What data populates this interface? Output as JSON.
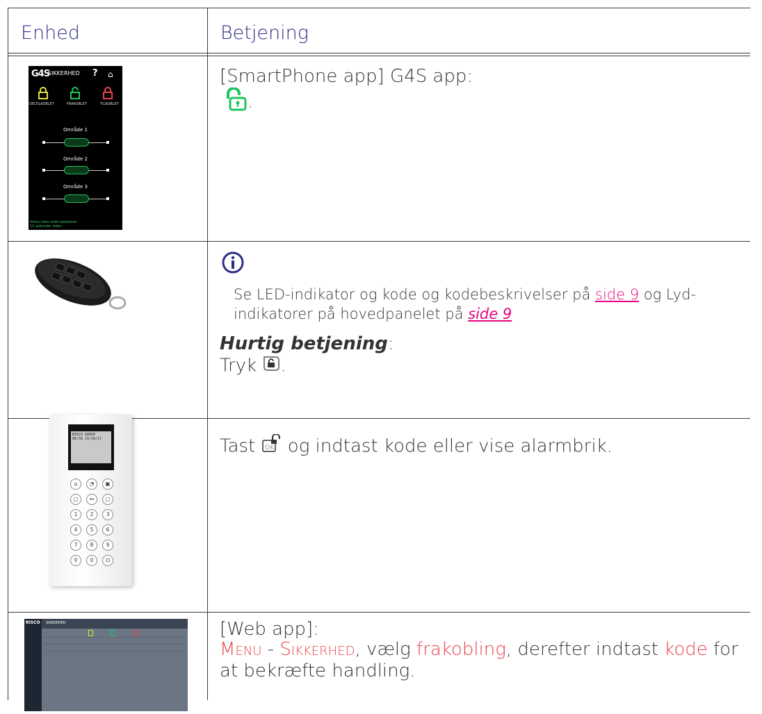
{
  "table": {
    "header": {
      "col_device": "Enhed",
      "col_operation": "Betjening"
    },
    "rows": [
      {
        "device_image": "smartphone-app-screenshot",
        "line1": "[SmartPhone app] G4S app:",
        "period": "."
      },
      {
        "device_image": "keyfob-remote",
        "info_prefix": "Se LED-indikator og kode og kodebeskrivelser på ",
        "link1": "side 9",
        "info_mid": " og Lyd-",
        "info_line2_prefix": "indikatorer på hovedpanelet på ",
        "link2": "side 9",
        "quick_label": "Hurtig betjening",
        "quick_colon": ":",
        "tryk_prefix": "Tryk ",
        "tryk_suffix": "."
      },
      {
        "device_image": "wall-keypad",
        "tast_prefix": "Tast ",
        "tast_suffix": " og indtast kode eller vise alarmbrik."
      },
      {
        "device_image": "web-app-screenshot",
        "line1": "[Web app]:",
        "menu_M": "M",
        "menu_rest": "ENU",
        "dash": " - ",
        "sik_S": "S",
        "sik_rest": "IKKERHED",
        "comma_valg": ", vælg ",
        "frakobling": "frakobling",
        "derefter": ", derefter indtast ",
        "kode": "kode",
        "for": " for",
        "line3": "at bekræfte handling."
      }
    ]
  },
  "phone": {
    "brand": "G4S",
    "title": "SIKKERHED",
    "labels": [
      "DELTILKOBLET",
      "FRAKOBLET",
      "TILKOBLET"
    ],
    "areas": [
      "Område 1",
      "Område 2",
      "Område 3"
    ],
    "status_line1": "Status blev sidst opdateret",
    "status_line2": "13 sekunder siden"
  },
  "keypad": {
    "lcd_line1": "RISCO GROUP",
    "lcd_line2": "08:50   15/10/17",
    "keys": [
      "1",
      "2",
      "3",
      "4",
      "5",
      "6",
      "7",
      "8",
      "9",
      "0"
    ]
  },
  "web": {
    "logo": "RISCO",
    "title": "SIKKERHED"
  },
  "colors": {
    "header_text": "#2f2e87",
    "red": "#e8414b",
    "link": "#e8007d",
    "unlock_green": "#1cc45c"
  }
}
